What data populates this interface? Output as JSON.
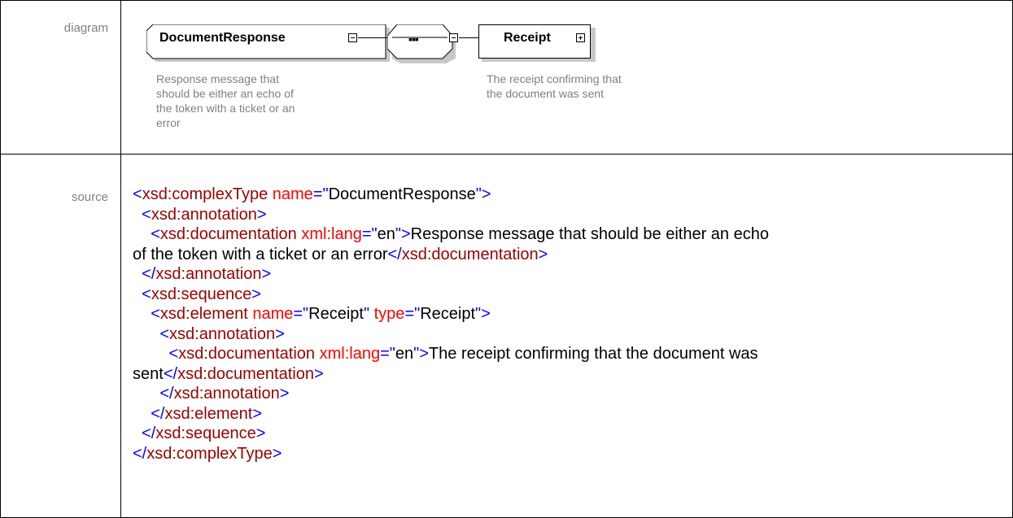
{
  "labels": {
    "diagram": "diagram",
    "source": "source"
  },
  "diagram": {
    "root_element": "DocumentResponse",
    "root_annotation": [
      "Response message that",
      "should be either an echo of",
      "the token with a ticket or an",
      "error"
    ],
    "sequence_symbol": "▪▪▪",
    "child_element": "Receipt",
    "child_annotation": [
      "The receipt confirming that",
      "the document was sent"
    ]
  },
  "source": {
    "lines": [
      [
        {
          "c": "t",
          "s": "<"
        },
        {
          "c": "n",
          "s": "xsd:complexType"
        },
        {
          "c": "v",
          "s": " "
        },
        {
          "c": "a",
          "s": "name"
        },
        {
          "c": "t",
          "s": "=\""
        },
        {
          "c": "v",
          "s": "DocumentResponse"
        },
        {
          "c": "t",
          "s": "\">"
        }
      ],
      [
        {
          "c": "v",
          "s": "  "
        },
        {
          "c": "t",
          "s": "<"
        },
        {
          "c": "n",
          "s": "xsd:annotation"
        },
        {
          "c": "t",
          "s": ">"
        }
      ],
      [
        {
          "c": "v",
          "s": "    "
        },
        {
          "c": "t",
          "s": "<"
        },
        {
          "c": "n",
          "s": "xsd:documentation"
        },
        {
          "c": "v",
          "s": " "
        },
        {
          "c": "a",
          "s": "xml:lang"
        },
        {
          "c": "t",
          "s": "=\""
        },
        {
          "c": "v",
          "s": "en"
        },
        {
          "c": "t",
          "s": "\">"
        },
        {
          "c": "v",
          "s": "Response message that should be either an echo"
        }
      ],
      [
        {
          "c": "v",
          "s": "of the token with a ticket or an error"
        },
        {
          "c": "t",
          "s": "</"
        },
        {
          "c": "n",
          "s": "xsd:documentation"
        },
        {
          "c": "t",
          "s": ">"
        }
      ],
      [
        {
          "c": "v",
          "s": "  "
        },
        {
          "c": "t",
          "s": "</"
        },
        {
          "c": "n",
          "s": "xsd:annotation"
        },
        {
          "c": "t",
          "s": ">"
        }
      ],
      [
        {
          "c": "v",
          "s": "  "
        },
        {
          "c": "t",
          "s": "<"
        },
        {
          "c": "n",
          "s": "xsd:sequence"
        },
        {
          "c": "t",
          "s": ">"
        }
      ],
      [
        {
          "c": "v",
          "s": "    "
        },
        {
          "c": "t",
          "s": "<"
        },
        {
          "c": "n",
          "s": "xsd:element"
        },
        {
          "c": "v",
          "s": " "
        },
        {
          "c": "a",
          "s": "name"
        },
        {
          "c": "t",
          "s": "=\""
        },
        {
          "c": "v",
          "s": "Receipt"
        },
        {
          "c": "t",
          "s": "\""
        },
        {
          "c": "v",
          "s": " "
        },
        {
          "c": "a",
          "s": "type"
        },
        {
          "c": "t",
          "s": "=\""
        },
        {
          "c": "v",
          "s": "Receipt"
        },
        {
          "c": "t",
          "s": "\">"
        }
      ],
      [
        {
          "c": "v",
          "s": "      "
        },
        {
          "c": "t",
          "s": "<"
        },
        {
          "c": "n",
          "s": "xsd:annotation"
        },
        {
          "c": "t",
          "s": ">"
        }
      ],
      [
        {
          "c": "v",
          "s": "        "
        },
        {
          "c": "t",
          "s": "<"
        },
        {
          "c": "n",
          "s": "xsd:documentation"
        },
        {
          "c": "v",
          "s": " "
        },
        {
          "c": "a",
          "s": "xml:lang"
        },
        {
          "c": "t",
          "s": "=\""
        },
        {
          "c": "v",
          "s": "en"
        },
        {
          "c": "t",
          "s": "\">"
        },
        {
          "c": "v",
          "s": "The receipt confirming that the document was"
        }
      ],
      [
        {
          "c": "v",
          "s": "sent"
        },
        {
          "c": "t",
          "s": "</"
        },
        {
          "c": "n",
          "s": "xsd:documentation"
        },
        {
          "c": "t",
          "s": ">"
        }
      ],
      [
        {
          "c": "v",
          "s": "      "
        },
        {
          "c": "t",
          "s": "</"
        },
        {
          "c": "n",
          "s": "xsd:annotation"
        },
        {
          "c": "t",
          "s": ">"
        }
      ],
      [
        {
          "c": "v",
          "s": "    "
        },
        {
          "c": "t",
          "s": "</"
        },
        {
          "c": "n",
          "s": "xsd:element"
        },
        {
          "c": "t",
          "s": ">"
        }
      ],
      [
        {
          "c": "v",
          "s": "  "
        },
        {
          "c": "t",
          "s": "</"
        },
        {
          "c": "n",
          "s": "xsd:sequence"
        },
        {
          "c": "t",
          "s": ">"
        }
      ],
      [
        {
          "c": "t",
          "s": "</"
        },
        {
          "c": "n",
          "s": "xsd:complexType"
        },
        {
          "c": "t",
          "s": ">"
        }
      ]
    ]
  }
}
